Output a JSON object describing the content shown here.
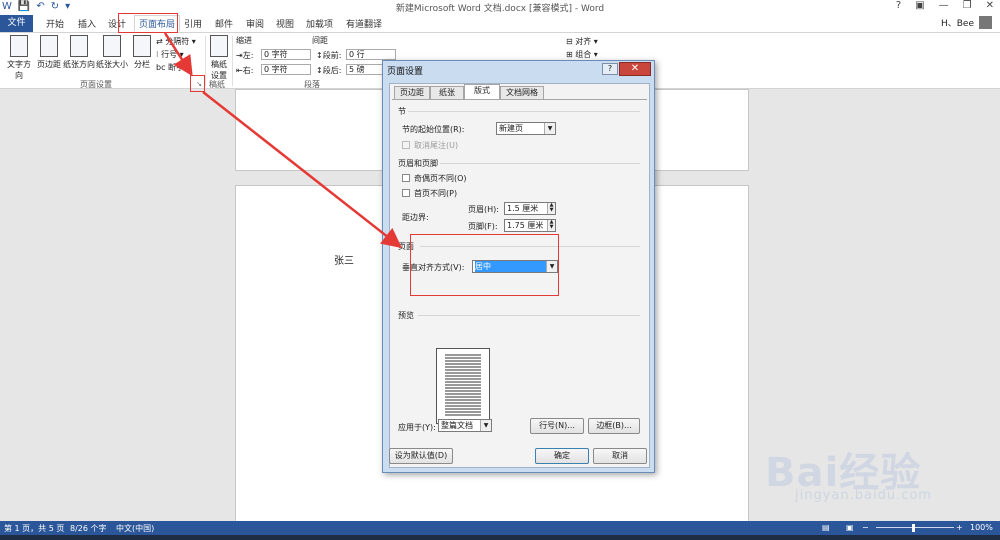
{
  "window": {
    "title": "新建Microsoft Word 文档.docx [兼容模式] - Word",
    "help": "?",
    "user": "H、Bee"
  },
  "tabs": [
    "开始",
    "插入",
    "设计",
    "页面布局",
    "引用",
    "邮件",
    "审阅",
    "视图",
    "加载项",
    "有道翻译"
  ],
  "file_tab": "文件",
  "active_tab": "页面布局",
  "ribbon": {
    "page_setup": {
      "buttons": [
        "文字方向",
        "页边距",
        "纸张方向",
        "纸张大小",
        "分栏"
      ],
      "small": [
        "分隔符",
        "行号",
        "断字"
      ],
      "group_label": "页面设置"
    },
    "draft": {
      "button": "稿纸设置",
      "group_label": "稿纸"
    },
    "paragraph": {
      "indent_label": "缩进",
      "spacing_label": "间距",
      "left_label": "左:",
      "left_value": "0 字符",
      "right_label": "右:",
      "right_value": "0 字符",
      "before_label": "段前:",
      "before_value": "0 行",
      "after_label": "段后:",
      "after_value": "5 磅",
      "group_label": "段落"
    },
    "arrange": {
      "align": "对齐",
      "group": "组合"
    }
  },
  "document": {
    "text": "张三"
  },
  "status": {
    "page": "第 1 页，共 5 页",
    "words": "8/26 个字",
    "lang": "中文(中国)",
    "zoom": "100%",
    "zoom_level": 0.5
  },
  "watermark": {
    "brand": "Bai经验",
    "url": "jingyan.baidu.com"
  },
  "dialog": {
    "title": "页面设置",
    "tabs": [
      "页边距",
      "纸张",
      "版式",
      "文档网格"
    ],
    "active_tab": "版式",
    "section": {
      "heading": "节",
      "start_label": "节的起始位置(R):",
      "start_value": "新建页",
      "suppress_endnotes": "取消尾注(U)"
    },
    "header_footer": {
      "heading": "页眉和页脚",
      "odd_even": "奇偶页不同(O)",
      "first_page": "首页不同(P)",
      "from_edge": "距边界:",
      "header_label": "页眉(H):",
      "header_value": "1.5 厘米",
      "footer_label": "页脚(F):",
      "footer_value": "1.75 厘米"
    },
    "page": {
      "heading": "页面",
      "valign_label": "垂直对齐方式(V):",
      "valign_value": "居中"
    },
    "preview": {
      "heading": "预览"
    },
    "apply": {
      "label": "应用于(Y):",
      "value": "整篇文档"
    },
    "buttons": {
      "line_numbers": "行号(N)...",
      "borders": "边框(B)...",
      "set_default": "设为默认值(D)",
      "ok": "确定",
      "cancel": "取消"
    }
  },
  "colors": {
    "accent": "#2b579a",
    "annotation": "#e53935",
    "highlight": "#3399ff"
  }
}
